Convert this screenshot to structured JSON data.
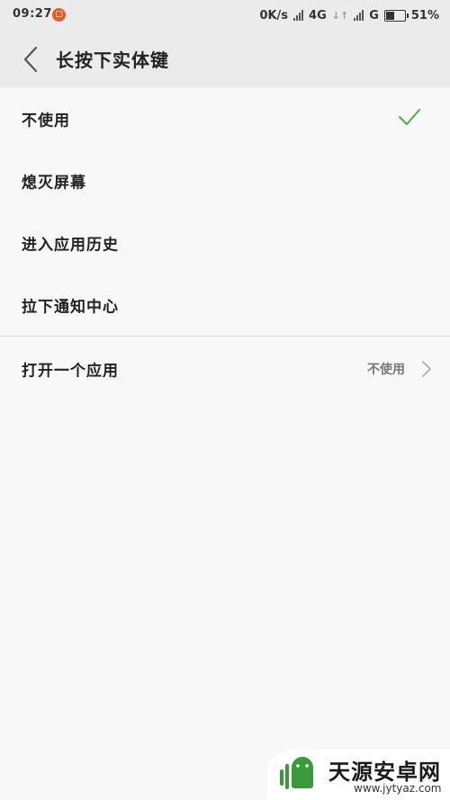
{
  "status_bar": {
    "time": "09:27",
    "notification_glyph": "□",
    "net_speed": "0K/s",
    "network_4g": "4G",
    "network_g": "G",
    "battery_percent": "51%",
    "battery_level": 0.51
  },
  "toolbar": {
    "back_icon": "chevron-left-icon",
    "title": "长按下实体键"
  },
  "options": [
    {
      "label": "不使用",
      "selected": true
    },
    {
      "label": "熄灭屏幕",
      "selected": false
    },
    {
      "label": "进入应用历史",
      "selected": false
    },
    {
      "label": "拉下通知中心",
      "selected": false
    }
  ],
  "open_app": {
    "label": "打开一个应用",
    "value": "不使用",
    "icon": "chevron-right-icon"
  },
  "watermark": {
    "title": "天源安卓网",
    "url": "www.jytyaz.com"
  },
  "colors": {
    "accent_check": "#4caf50",
    "watermark_green": "#3a9a3a"
  }
}
